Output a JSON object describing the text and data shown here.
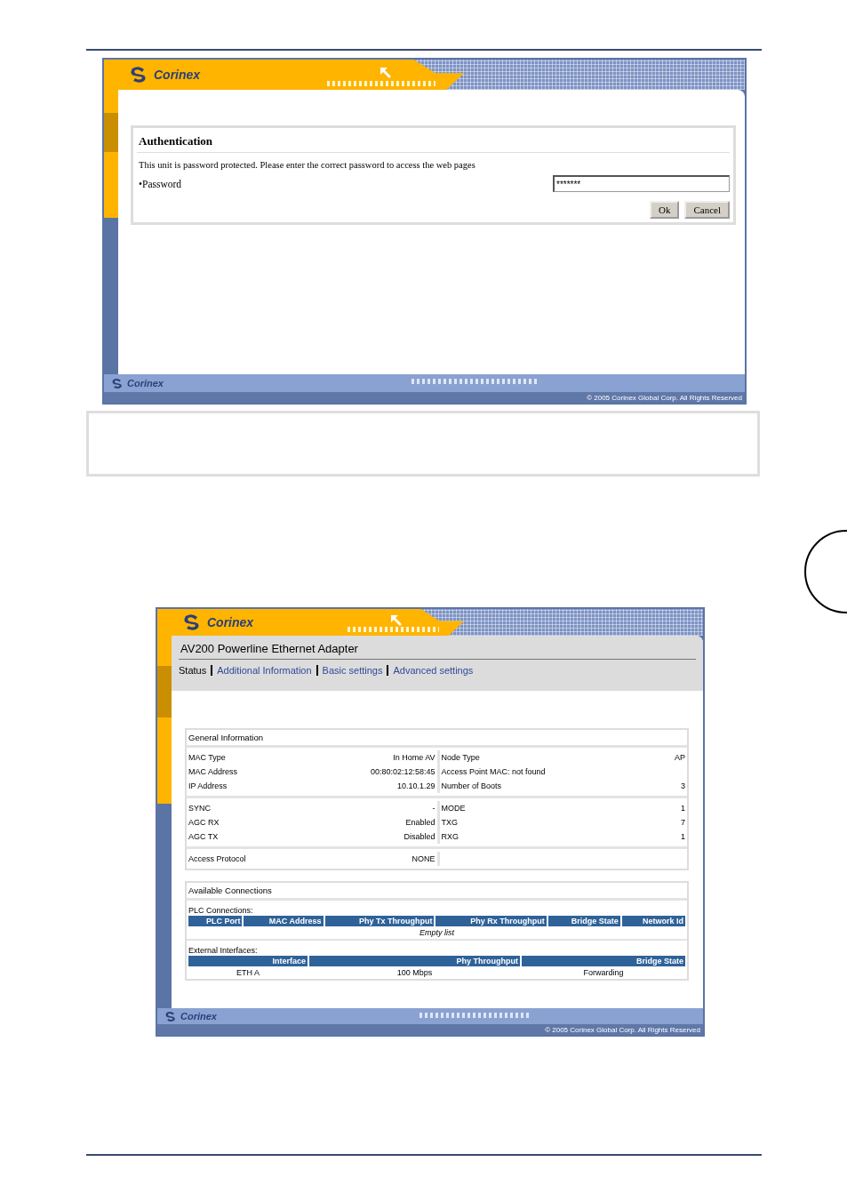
{
  "auth_window": {
    "logo": "Corinex",
    "title": "Authentication",
    "message": "This unit is password protected. Please enter the correct password to access the web pages",
    "password_label": "•Password",
    "password_value": "*******",
    "buttons": [
      "Ok",
      "Cancel"
    ],
    "footer_logo": "Corinex",
    "copyright": "© 2005 Corinex Global Corp. All Rights Reserved"
  },
  "status_window": {
    "logo": "Corinex",
    "title": "AV200 Powerline Ethernet Adapter",
    "nav": [
      {
        "label": "Status",
        "selected": true
      },
      {
        "label": "Additional Information",
        "selected": false
      },
      {
        "label": "Basic settings",
        "selected": false
      },
      {
        "label": "Advanced settings",
        "selected": false
      }
    ],
    "general_info": {
      "title": "General Information",
      "groups": [
        [
          [
            "MAC Type",
            "In Home AV",
            "Node Type",
            "AP"
          ],
          [
            "MAC Address",
            "00:80:02:12:58:45",
            "Access Point MAC: not found"
          ],
          [
            "IP Address",
            "10.10.1.29",
            "Number of Boots",
            "3"
          ]
        ],
        [
          [
            "SYNC",
            "-",
            "MODE",
            "1"
          ],
          [
            "AGC RX",
            "Enabled",
            "TXG",
            "7"
          ],
          [
            "AGC TX",
            "Disabled",
            "RXG",
            "1"
          ]
        ],
        [
          [
            "Access Protocol",
            "NONE"
          ]
        ]
      ]
    },
    "connections": {
      "title": "Available Connections",
      "plc_label": "PLC Connections:",
      "plc_columns": [
        "PLC Port",
        "MAC Address",
        "Phy Tx Throughput",
        "Phy Rx Throughput",
        "Bridge State",
        "Network Id"
      ],
      "plc_empty": "Empty list",
      "ext_label": "External Interfaces:",
      "ext_columns": [
        "Interface",
        "Phy Throughput",
        "Bridge State"
      ],
      "ext_rows": [
        [
          "ETH A",
          "100 Mbps",
          "Forwarding"
        ]
      ]
    },
    "footer_logo": "Corinex",
    "copyright": "© 2005 Corinex Global Corp. All Rights Reserved"
  }
}
